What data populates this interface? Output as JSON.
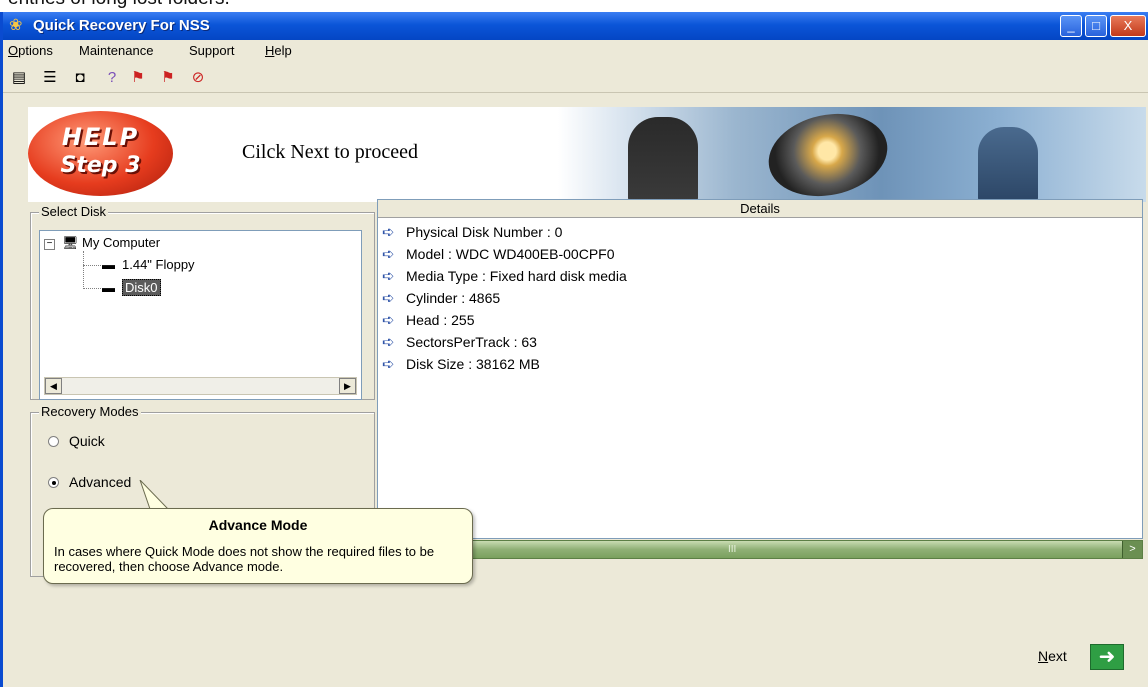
{
  "caption": "entries of long lost folders.",
  "window": {
    "title": "Quick Recovery For NSS",
    "controls": {
      "minimize": "_",
      "maximize": "□",
      "close": "X"
    }
  },
  "menu": {
    "items": [
      {
        "label": "Options",
        "accel": "O"
      },
      {
        "label": "Maintenance",
        "accel": ""
      },
      {
        "label": "Support",
        "accel": ""
      },
      {
        "label": "Help",
        "accel": "H"
      }
    ]
  },
  "toolbar": {
    "icons": [
      "properties-icon",
      "list-icon",
      "save-icon",
      "help-icon",
      "recover-icon",
      "recover-alt-icon",
      "link-icon"
    ]
  },
  "banner": {
    "help_line1": "HELP",
    "help_line2": "Step 3",
    "instruction": "Cilck Next to proceed"
  },
  "select_disk": {
    "legend": "Select Disk",
    "root": "My Computer",
    "items": [
      "1.44\" Floppy",
      "Disk0"
    ],
    "selected": "Disk0"
  },
  "recovery_modes": {
    "legend": "Recovery Modes",
    "options": [
      "Quick",
      "Advanced"
    ],
    "selected": "Advanced"
  },
  "details": {
    "header": "Details",
    "rows": [
      "Physical Disk Number : 0",
      "Model   : WDC WD400EB-00CPF0",
      "Media Type   : Fixed hard disk media",
      "Cylinder   : 4865",
      "Head   : 255",
      "SectorsPerTrack   : 63",
      "Disk Size  : 38162 MB"
    ]
  },
  "scrollbar": {
    "grip": "III",
    "arrow": ">"
  },
  "tooltip": {
    "title": "Advance Mode",
    "body": "In cases where Quick Mode does not show the required files to be recovered, then choose Advance mode."
  },
  "next": {
    "label": "Next"
  }
}
